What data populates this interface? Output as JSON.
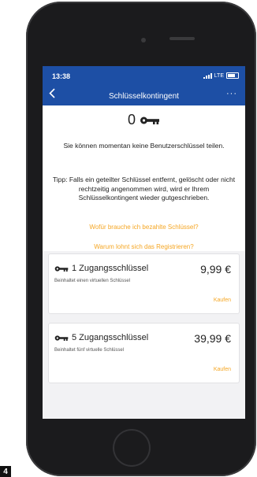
{
  "status_bar": {
    "time": "13:38",
    "carrier": "LTE"
  },
  "nav": {
    "back_icon": "chevron-left-icon",
    "title": "Schlüsselkontingent",
    "more": "···"
  },
  "key_count": {
    "value": "0",
    "icon": "key-icon"
  },
  "info_text": "Sie können momentan keine Benutzerschlüssel teilen.",
  "tip_text": "Tipp: Falls ein geteilter Schlüssel entfernt, gelöscht oder nicht rechtzeitig angenommen wird, wird er Ihrem Schlüsselkontingent wieder gutgeschrieben.",
  "links": {
    "why_paid": "Wofür brauche ich bezahlte Schlüssel?",
    "why_register": "Warum lohnt sich das Registrieren?"
  },
  "products": [
    {
      "title": "1 Zugangsschlüssel",
      "price": "9,99 €",
      "description": "Beinhaltet einen virtuellen Schlüssel",
      "buy_label": "Kaufen"
    },
    {
      "title": "5 Zugangsschlüssel",
      "price": "39,99 €",
      "description": "Beinhaltet fünf virtuelle Schlüssel",
      "buy_label": "Kaufen"
    }
  ],
  "step_label": "4",
  "colors": {
    "header": "#1d4fa5",
    "accent": "#f5a623",
    "phone": "#1b1b1d"
  }
}
